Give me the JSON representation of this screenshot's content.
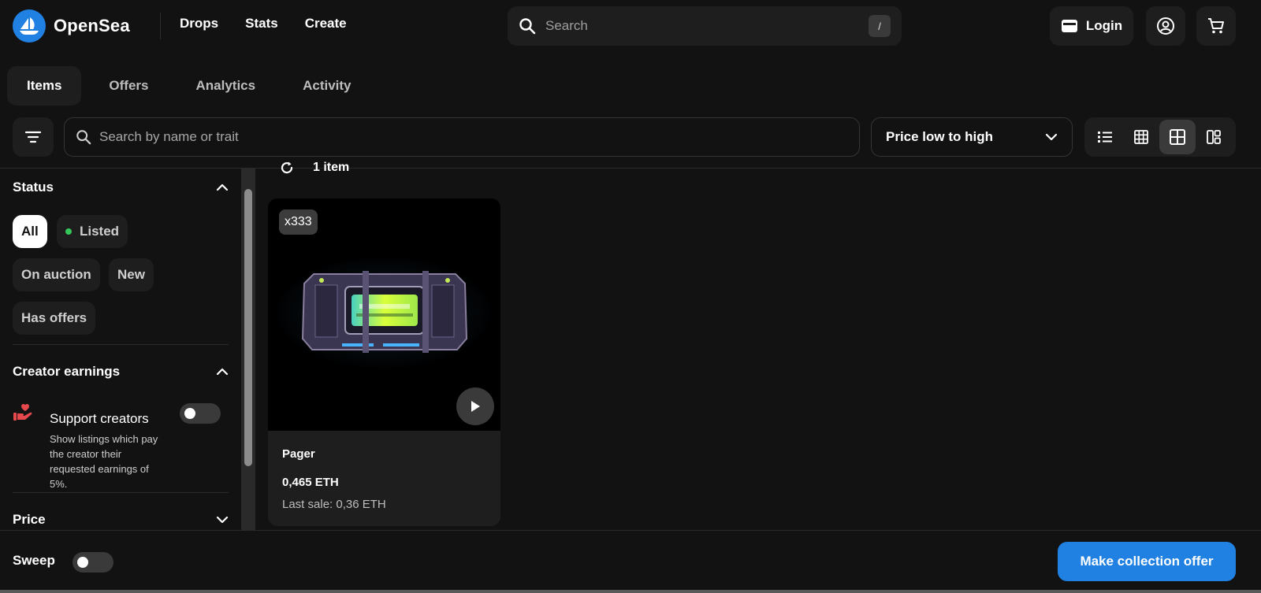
{
  "header": {
    "brand": "OpenSea",
    "nav": [
      "Drops",
      "Stats",
      "Create"
    ],
    "search_placeholder": "Search",
    "search_shortcut": "/",
    "login_label": "Login"
  },
  "tabs": [
    {
      "label": "Items",
      "active": true
    },
    {
      "label": "Offers",
      "active": false
    },
    {
      "label": "Analytics",
      "active": false
    },
    {
      "label": "Activity",
      "active": false
    }
  ],
  "toolbar": {
    "trait_search_placeholder": "Search by name or trait",
    "sort_value": "Price low to high",
    "view_modes": [
      "list-view-icon",
      "small-grid-icon",
      "large-grid-icon",
      "split-view-icon"
    ],
    "active_view": "large-grid-icon"
  },
  "sidebar": {
    "status": {
      "title": "Status",
      "chips": [
        {
          "label": "All",
          "active": true
        },
        {
          "label": "Listed",
          "active": false
        },
        {
          "label": "On auction",
          "active": false
        },
        {
          "label": "New",
          "active": false
        },
        {
          "label": "Has offers",
          "active": false
        }
      ]
    },
    "creator_earnings": {
      "title": "Creator earnings",
      "support_title": "Support creators",
      "support_desc": "Show listings which pay the creator their requested earnings of 5%.",
      "enabled": false
    },
    "price": {
      "title": "Price"
    }
  },
  "results": {
    "count_label": "1 item",
    "card": {
      "quantity": "x333",
      "name": "Pager",
      "price": "0,465 ETH",
      "last_sale": "Last sale: 0,36 ETH"
    }
  },
  "bottom": {
    "sweep_label": "Sweep",
    "sweep_enabled": false,
    "offer_button": "Make collection offer"
  },
  "colors": {
    "background": "#121212",
    "surface": "#1e1e1e",
    "accent": "#2081e2",
    "listed_dot": "#34c759",
    "heart": "#e5484d"
  }
}
